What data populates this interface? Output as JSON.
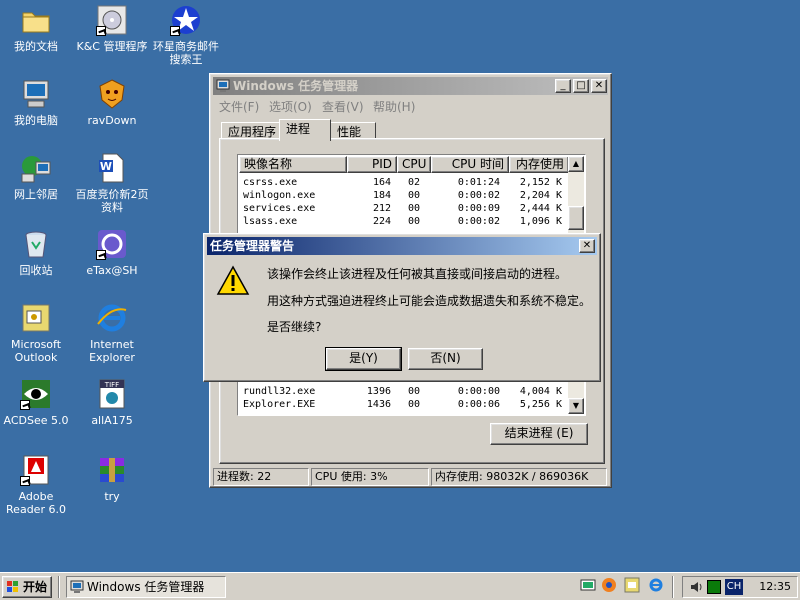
{
  "desktop": {
    "icons": [
      {
        "label": "我的文档",
        "icon": "folder-icon"
      },
      {
        "label": "K&C 管理程序",
        "icon": "cd-drive-icon"
      },
      {
        "label": "环星商务邮件搜索王",
        "icon": "star-icon"
      },
      {
        "label": "我的电脑",
        "icon": "computer-icon"
      },
      {
        "label": "ravDown",
        "icon": "lion-icon"
      },
      {
        "label": "网上邻居",
        "icon": "network-icon"
      },
      {
        "label": "百度竞价新2页资料",
        "icon": "word-doc-icon"
      },
      {
        "label": "回收站",
        "icon": "recycle-bin-icon"
      },
      {
        "label": "eTax@SH",
        "icon": "etax-icon"
      },
      {
        "label": "Microsoft Outlook",
        "icon": "outlook-icon"
      },
      {
        "label": "Internet Explorer",
        "icon": "ie-icon"
      },
      {
        "label": "ACDSee 5.0",
        "icon": "acdsee-eye-icon"
      },
      {
        "label": "allA175",
        "icon": "tiff-icon"
      },
      {
        "label": "Adobe Reader 6.0",
        "icon": "adobe-reader-icon"
      },
      {
        "label": "try",
        "icon": "winrar-icon"
      }
    ]
  },
  "task_manager": {
    "title": "Windows 任务管理器",
    "menu": [
      "文件(F)",
      "选项(O)",
      "查看(V)",
      "帮助(H)"
    ],
    "tabs": [
      "应用程序",
      "进程",
      "性能"
    ],
    "columns": [
      "映像名称",
      "PID",
      "CPU",
      "CPU 时间",
      "内存使用"
    ],
    "rows_top": [
      {
        "name": "csrss.exe",
        "pid": "164",
        "cpu": "02",
        "time": "0:01:24",
        "mem": "2,152 K"
      },
      {
        "name": "winlogon.exe",
        "pid": "184",
        "cpu": "00",
        "time": "0:00:02",
        "mem": "2,204 K"
      },
      {
        "name": "services.exe",
        "pid": "212",
        "cpu": "00",
        "time": "0:00:09",
        "mem": "2,444 K"
      },
      {
        "name": "lsass.exe",
        "pid": "224",
        "cpu": "00",
        "time": "0:00:02",
        "mem": "1,096 K"
      }
    ],
    "rows_bottom": [
      {
        "name": "rundll32.exe",
        "pid": "1396",
        "cpu": "00",
        "time": "0:00:00",
        "mem": "4,004 K"
      },
      {
        "name": "Explorer.EXE",
        "pid": "1436",
        "cpu": "00",
        "time": "0:00:06",
        "mem": "5,256 K"
      }
    ],
    "end_process_button": "结束进程 (E)",
    "status": {
      "processes": "进程数: 22",
      "cpu": "CPU 使用: 3%",
      "memory": "内存使用: 98032K / 869036K"
    }
  },
  "dialog": {
    "title": "任务管理器警告",
    "line1": "该操作会终止该进程及任何被其直接或间接启动的进程。",
    "line2": "用这种方式强迫进程终止可能会造成数据遗失和系统不稳定。",
    "line3": "是否继续?",
    "yes": "是(Y)",
    "no": "否(N)"
  },
  "taskbar": {
    "start": "开始",
    "task_button": "Windows 任务管理器",
    "tray_lang": "CH",
    "clock": "12:35"
  }
}
